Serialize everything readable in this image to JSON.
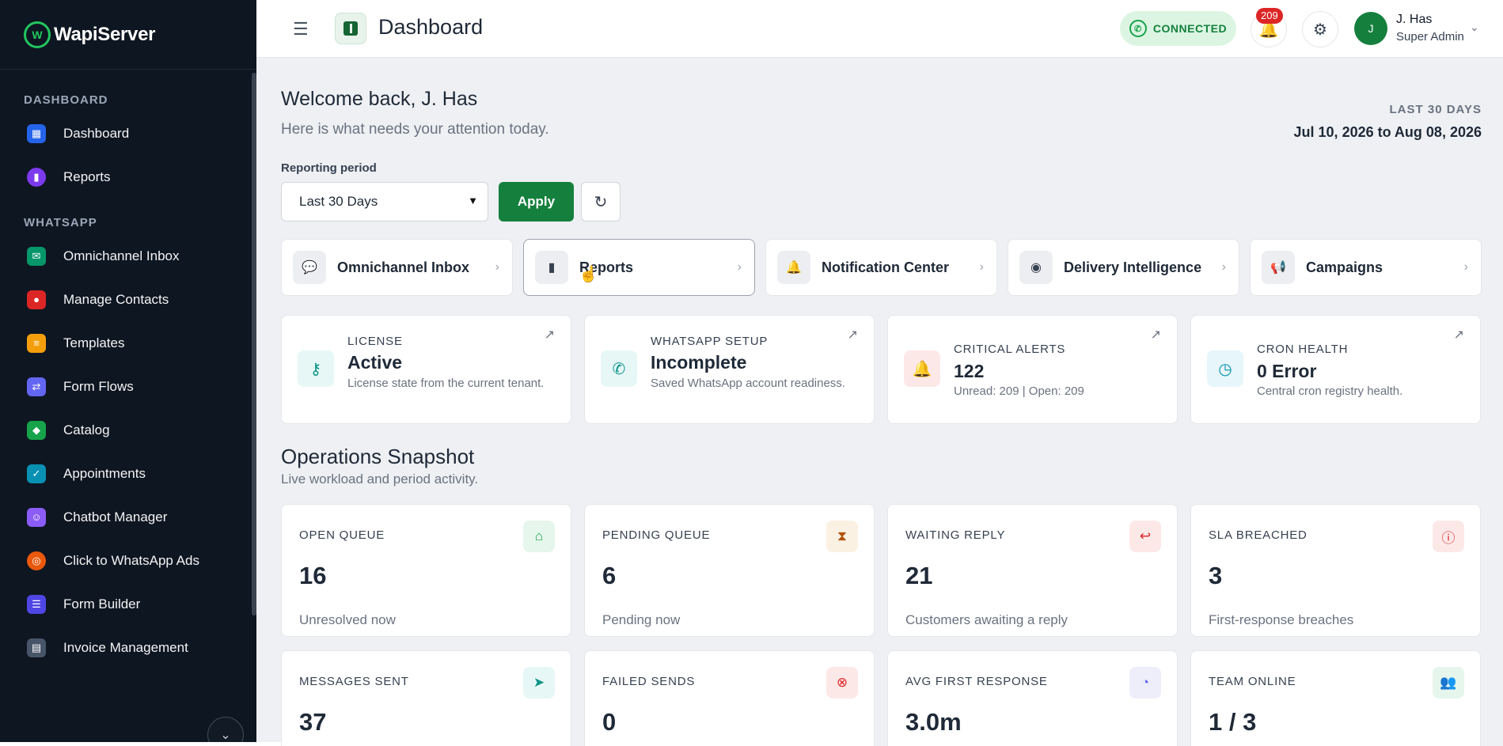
{
  "brand": {
    "name": "WapiServer"
  },
  "sidebar": {
    "sections": [
      {
        "title": "DASHBOARD",
        "items": [
          {
            "label": "Dashboard",
            "icon": "grid-icon",
            "color": "#2563eb"
          },
          {
            "label": "Reports",
            "icon": "bar-chart-icon",
            "color": "#7c3aed"
          }
        ]
      },
      {
        "title": "WHATSAPP",
        "items": [
          {
            "label": "Omnichannel Inbox",
            "icon": "chat-icon",
            "color": "#059669"
          },
          {
            "label": "Manage Contacts",
            "icon": "contacts-icon",
            "color": "#dc2626"
          },
          {
            "label": "Templates",
            "icon": "document-icon",
            "color": "#f59e0b"
          },
          {
            "label": "Form Flows",
            "icon": "flow-icon",
            "color": "#6366f1"
          },
          {
            "label": "Catalog",
            "icon": "bag-icon",
            "color": "#16a34a"
          },
          {
            "label": "Appointments",
            "icon": "calendar-icon",
            "color": "#0891b2"
          },
          {
            "label": "Chatbot Manager",
            "icon": "robot-icon",
            "color": "#8b5cf6"
          },
          {
            "label": "Click to WhatsApp Ads",
            "icon": "target-icon",
            "color": "#ea580c"
          },
          {
            "label": "Form Builder",
            "icon": "form-icon",
            "color": "#4f46e5"
          },
          {
            "label": "Invoice Management",
            "icon": "invoice-icon",
            "color": "#475569"
          }
        ]
      }
    ]
  },
  "topbar": {
    "title": "Dashboard",
    "connection_status": "CONNECTED",
    "notification_count": "209",
    "user": {
      "initial": "J",
      "name": "J. Has",
      "role": "Super Admin"
    }
  },
  "welcome": {
    "title": "Welcome back, J. Has",
    "subtitle": "Here is what needs your attention today."
  },
  "date_range": {
    "label": "LAST 30 DAYS",
    "value": "Jul 10, 2026 to Aug 08, 2026"
  },
  "reporting": {
    "label": "Reporting period",
    "selected": "Last 30 Days",
    "apply_label": "Apply"
  },
  "quick_links": [
    {
      "label": "Omnichannel Inbox",
      "icon": "chat-icon"
    },
    {
      "label": "Reports",
      "icon": "bar-chart-icon"
    },
    {
      "label": "Notification Center",
      "icon": "bell-icon"
    },
    {
      "label": "Delivery Intelligence",
      "icon": "broadcast-icon"
    },
    {
      "label": "Campaigns",
      "icon": "megaphone-icon"
    }
  ],
  "status_cards": [
    {
      "title": "LICENSE",
      "value": "Active",
      "desc": "License state from the current tenant.",
      "icon": "key-icon",
      "color": "#0d9488",
      "bg": "#e6f7f6"
    },
    {
      "title": "WHATSAPP SETUP",
      "value": "Incomplete",
      "desc": "Saved WhatsApp account readiness.",
      "icon": "whatsapp-icon",
      "color": "#0d9488",
      "bg": "#e6f7f6"
    },
    {
      "title": "CRITICAL ALERTS",
      "value": "122",
      "desc": "Unread: 209 | Open: 209",
      "icon": "bell-icon",
      "color": "#dc2626",
      "bg": "#fde8e8"
    },
    {
      "title": "CRON HEALTH",
      "value": "0 Error",
      "desc": "Central cron registry health.",
      "icon": "clock-icon",
      "color": "#0891b2",
      "bg": "#e6f6fa"
    }
  ],
  "operations": {
    "title": "Operations Snapshot",
    "subtitle": "Live workload and period activity.",
    "metrics": [
      {
        "label": "OPEN QUEUE",
        "value": "16",
        "desc": "Unresolved now",
        "icon": "inbox-icon",
        "color": "#16a34a",
        "bg": "#e6f6ec"
      },
      {
        "label": "PENDING QUEUE",
        "value": "6",
        "desc": "Pending now",
        "icon": "hourglass-icon",
        "color": "#b45309",
        "bg": "#fbf1e3"
      },
      {
        "label": "WAITING REPLY",
        "value": "21",
        "desc": "Customers awaiting a reply",
        "icon": "reply-icon",
        "color": "#dc2626",
        "bg": "#fde8e8"
      },
      {
        "label": "SLA BREACHED",
        "value": "3",
        "desc": "First-response breaches",
        "icon": "alert-circle-icon",
        "color": "#dc2626",
        "bg": "#fde8e8"
      },
      {
        "label": "MESSAGES SENT",
        "value": "37",
        "desc": "",
        "icon": "send-icon",
        "color": "#0d9488",
        "bg": "#e6f7f6"
      },
      {
        "label": "FAILED SENDS",
        "value": "0",
        "desc": "",
        "icon": "x-circle-icon",
        "color": "#dc2626",
        "bg": "#fde8e8"
      },
      {
        "label": "AVG FIRST RESPONSE",
        "value": "3.0m",
        "desc": "",
        "icon": "stopwatch-icon",
        "color": "#6366f1",
        "bg": "#eeeefb"
      },
      {
        "label": "TEAM ONLINE",
        "value": "1 / 3",
        "desc": "",
        "icon": "users-icon",
        "color": "#16a34a",
        "bg": "#e6f6ec"
      }
    ]
  }
}
